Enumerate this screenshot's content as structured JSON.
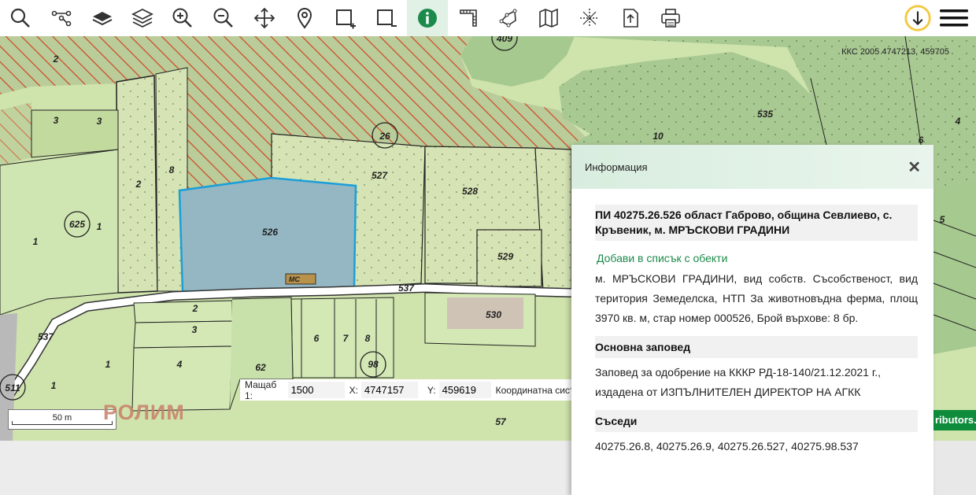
{
  "toolbar": {
    "buttons": [
      {
        "id": "search",
        "icon": "search-icon"
      },
      {
        "id": "route",
        "icon": "route-icon"
      },
      {
        "id": "layer",
        "icon": "layer-icon"
      },
      {
        "id": "layers",
        "icon": "layers-icon"
      },
      {
        "id": "zoom_in",
        "icon": "zoom-in-icon"
      },
      {
        "id": "zoom_out",
        "icon": "zoom-out-icon"
      },
      {
        "id": "pan",
        "icon": "pan-arrows-icon"
      },
      {
        "id": "locate",
        "icon": "location-pin-icon"
      },
      {
        "id": "select_rect",
        "icon": "select-rectangle-icon"
      },
      {
        "id": "deselect_rect",
        "icon": "deselect-rectangle-icon"
      },
      {
        "id": "info",
        "icon": "info-icon",
        "active": true
      },
      {
        "id": "measure",
        "icon": "measure-icon"
      },
      {
        "id": "polygon",
        "icon": "polygon-icon"
      },
      {
        "id": "map",
        "icon": "map-icon"
      },
      {
        "id": "grid",
        "icon": "grid-crosshair-icon"
      },
      {
        "id": "export",
        "icon": "export-icon"
      },
      {
        "id": "print",
        "icon": "print-icon"
      }
    ],
    "download_icon": "download-icon",
    "menu_icon": "hamburger-menu-icon",
    "accent_color": "#1b8a4a",
    "download_ring_color": "#f4c842"
  },
  "map": {
    "top_coordinates": "ККС 2005 4747213, 459705",
    "scale_label": "50 m",
    "watermark": "РОЛИМ",
    "credit": "ributors.",
    "parcel_labels": [
      {
        "text": "2"
      },
      {
        "text": "3"
      },
      {
        "text": "3"
      },
      {
        "text": "2"
      },
      {
        "text": "8"
      },
      {
        "text": "1"
      },
      {
        "text": "1"
      },
      {
        "text": "625"
      },
      {
        "text": "26"
      },
      {
        "text": "527"
      },
      {
        "text": "528"
      },
      {
        "text": "526"
      },
      {
        "text": "529"
      },
      {
        "text": "537"
      },
      {
        "text": "530"
      },
      {
        "text": "2"
      },
      {
        "text": "3"
      },
      {
        "text": "4"
      },
      {
        "text": "1"
      },
      {
        "text": "1"
      },
      {
        "text": "6"
      },
      {
        "text": "7"
      },
      {
        "text": "8"
      },
      {
        "text": "98"
      },
      {
        "text": "62"
      },
      {
        "text": "537"
      },
      {
        "text": "511"
      },
      {
        "text": "57"
      },
      {
        "text": "409"
      },
      {
        "text": "10"
      },
      {
        "text": "535"
      },
      {
        "text": "4"
      },
      {
        "text": "6"
      },
      {
        "text": "5"
      },
      {
        "text": "МС"
      }
    ]
  },
  "statusbar": {
    "scale_label": "Мащаб 1:",
    "scale_value": "1500",
    "x_label": "X:",
    "x_value": "4747157",
    "y_label": "Y:",
    "y_value": "459619",
    "coord_label": "Координатна систе"
  },
  "panel": {
    "title": "Информация",
    "close_icon": "close-icon",
    "property_title": "ПИ 40275.26.526 област Габрово, община Севлиево, с. Кръвеник, м. МРЪСКОВИ ГРАДИНИ",
    "add_link": "Добави в списък с обекти",
    "description": "м. МРЪСКОВИ ГРАДИНИ, вид собств. Съсобственост, вид територия Земеделска, НТП За животновъдна ферма, площ 3970 кв. м, стар номер 000526, Брой върхове: 8 бр.",
    "order_title": "Основна заповед",
    "order_text": "Заповед за одобрение на КККР РД-18-140/21.12.2021 г., издадена от ИЗПЪЛНИТЕЛЕН ДИРЕКТОР НА АГКК",
    "neighbors_title": "Съседи",
    "neighbors_text": "40275.26.8, 40275.26.9, 40275.26.527, 40275.98.537"
  }
}
